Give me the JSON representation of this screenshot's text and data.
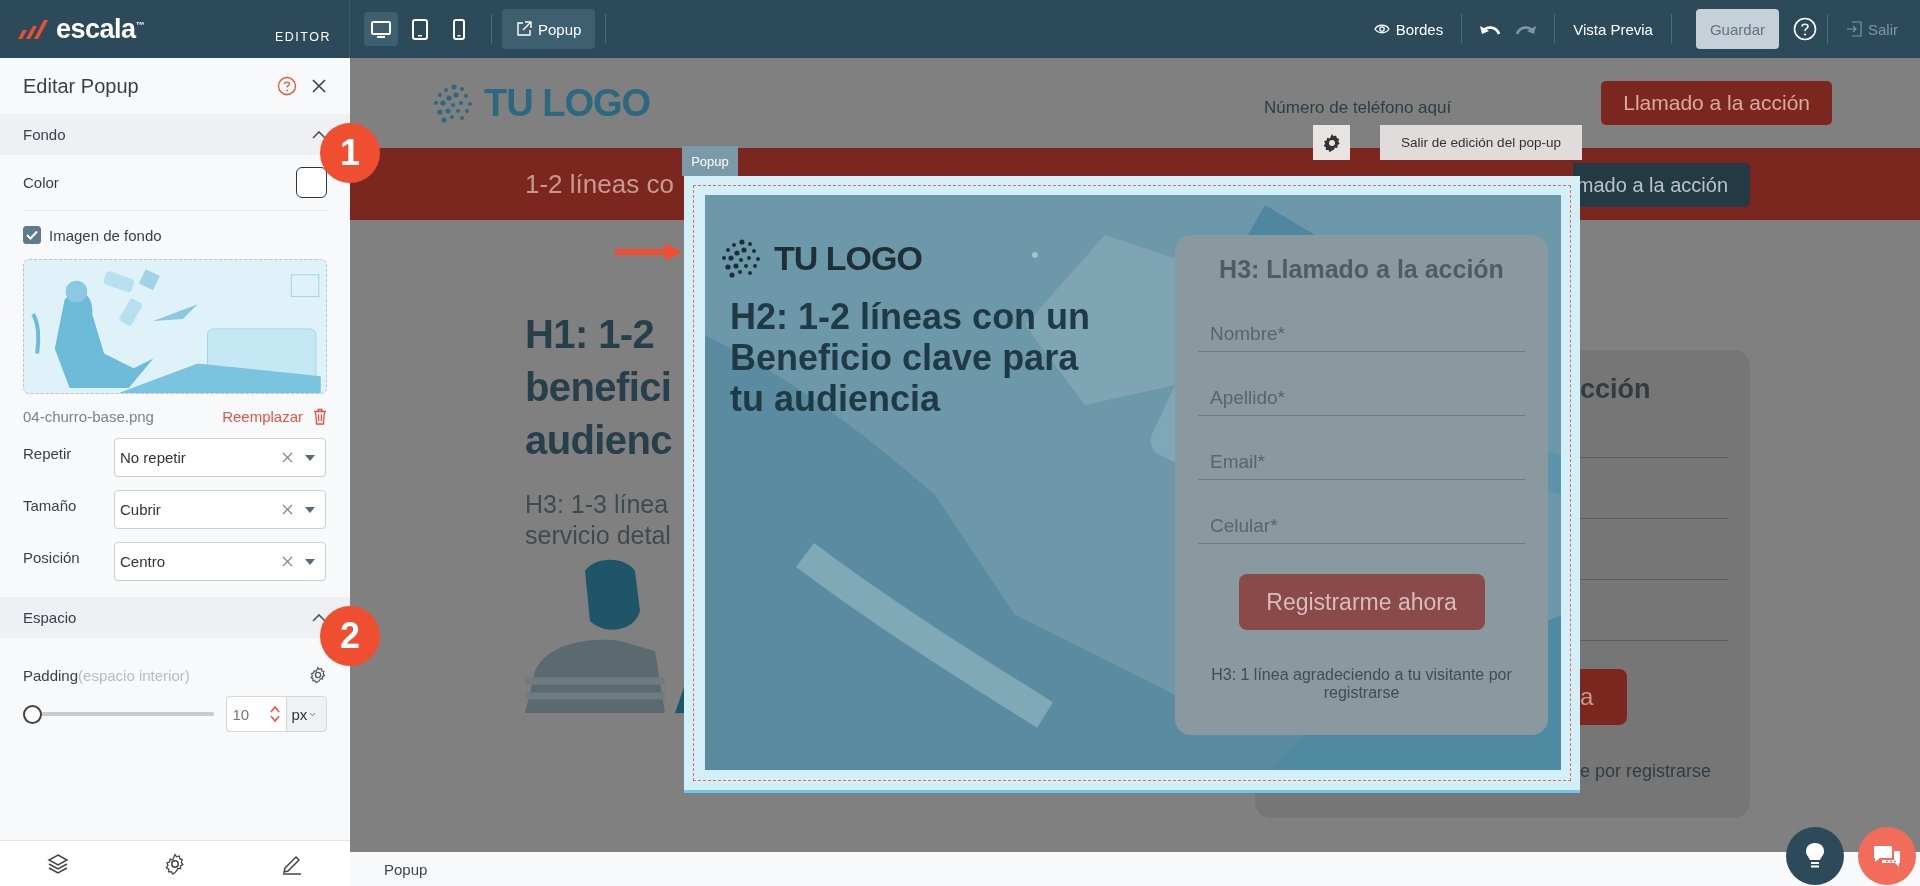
{
  "top_bar": {
    "brand": "escala$^{™}$",
    "mode": "EDITOR",
    "devices": [
      {
        "kind": "desktop",
        "selected": true
      },
      {
        "kind": "tablet",
        "selected": false
      },
      {
        "kind": "mobile",
        "selected": false
      }
    ],
    "popup_button": "Popup",
    "borders_button": "Bordes",
    "undo": {
      "disabled": false
    },
    "redo": {
      "disabled": true
    },
    "preview_button": "Vista Previa",
    "save_button": {
      "label": "Guardar",
      "disabled": true
    },
    "exit_button": {
      "label": "Salir",
      "disabled": true
    }
  },
  "panel": {
    "title": "Editar Popup",
    "sections": [
      {
        "kind": "background",
        "title": "Fondo",
        "expanded": true,
        "badge": "1",
        "color_label": "Color",
        "image_toggle": {
          "label": "Imagen de fondo",
          "checked": true
        },
        "file_name": "04-churro-base.png",
        "replace_link": "Reemplazar",
        "selects": [
          {
            "label": "Repetir",
            "value": "No repetir"
          },
          {
            "label": "Tamaño",
            "value": "Cubrir"
          },
          {
            "label": "Posición",
            "value": "Centro"
          }
        ]
      },
      {
        "kind": "spacing",
        "title": "Espacio",
        "expanded": true,
        "badge": "2",
        "label": "Padding",
        "hint": "(espacio interior)",
        "level": 0,
        "value": "10",
        "unit": "px"
      }
    ]
  },
  "page": {
    "logo": "TU LOGO",
    "phone": "Número de teléfono aquí",
    "header_button": "Llamado a la acción",
    "band_text": "1-2 líneas co",
    "band_button": "mado a la acción",
    "h1": "H1: 1-2\nbenefici\naudienc",
    "h3": "H3: 1-3 línea\nservicio detal",
    "form_heading": "cción",
    "form_button": "a",
    "form_note": "e por registrarse"
  },
  "popup": {
    "tag": "Popup",
    "exit_button": "Salir de edición del pop-up",
    "logo": "TU LOGO",
    "h2": "H2: 1-2 líneas con un Beneficio clave para tu audiencia",
    "form": {
      "heading": "H3: Llamado a la acción",
      "fields": [
        {
          "placeholder": "Nombre*"
        },
        {
          "placeholder": "Apellido*"
        },
        {
          "placeholder": "Email*"
        },
        {
          "placeholder": "Celular*"
        }
      ],
      "button": "Registrarme ahora",
      "note": "H3: 1 línea agradeciendo a tu visitante por registrarse"
    }
  },
  "status_bar": {
    "breadcrumb": "Popup"
  }
}
